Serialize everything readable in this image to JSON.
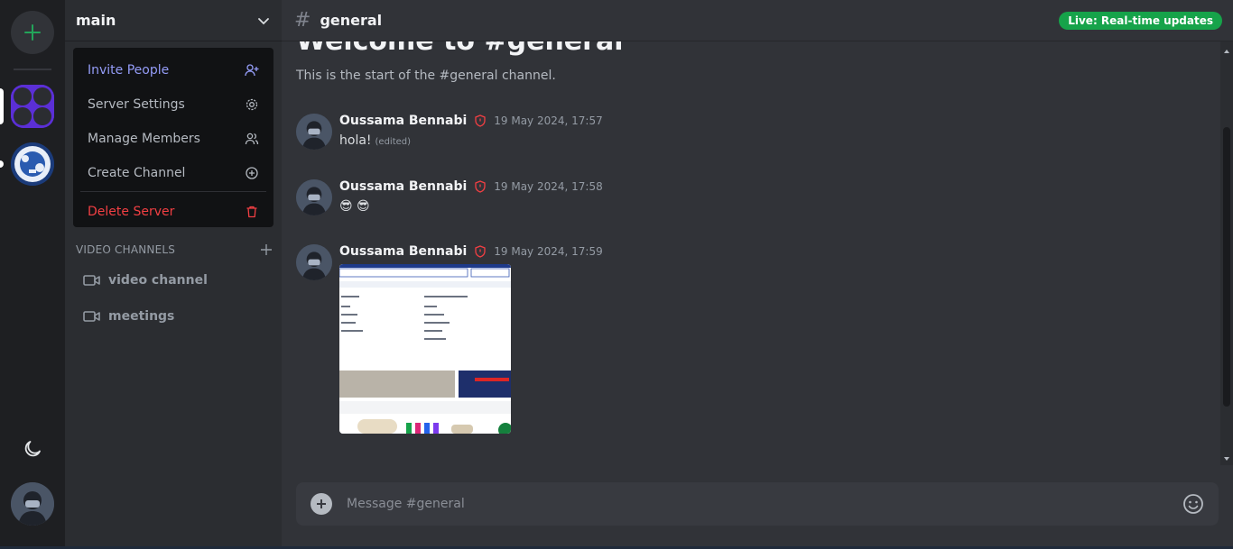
{
  "server_rail": {
    "add_label": "+",
    "servers": [
      "server-1",
      "server-2"
    ]
  },
  "sidebar": {
    "server_name": "main",
    "menu": {
      "invite": "Invite People",
      "settings": "Server Settings",
      "members": "Manage Members",
      "create_channel": "Create Channel",
      "delete": "Delete Server"
    },
    "video_section": "VIDEO CHANNELS",
    "channels": [
      "video channel",
      "meetings"
    ]
  },
  "header": {
    "hash": "#",
    "channel": "general",
    "live_badge": "Live: Real-time updates"
  },
  "welcome": {
    "title": "Welcome to #general",
    "subtitle": "This is the start of the #general channel."
  },
  "messages": [
    {
      "author": "Oussama Bennabi",
      "time": "19 May 2024, 17:57",
      "text": "hola!",
      "edited": "(edited)"
    },
    {
      "author": "Oussama Bennabi",
      "time": "19 May 2024, 17:58",
      "text": "😎 😎"
    },
    {
      "author": "Oussama Bennabi",
      "time": "19 May 2024, 17:59",
      "attachment": "image"
    }
  ],
  "composer": {
    "placeholder": "Message #general"
  },
  "colors": {
    "accent_blue": "#949cf7",
    "danger": "#f23f43",
    "live_green": "#16a34a"
  }
}
